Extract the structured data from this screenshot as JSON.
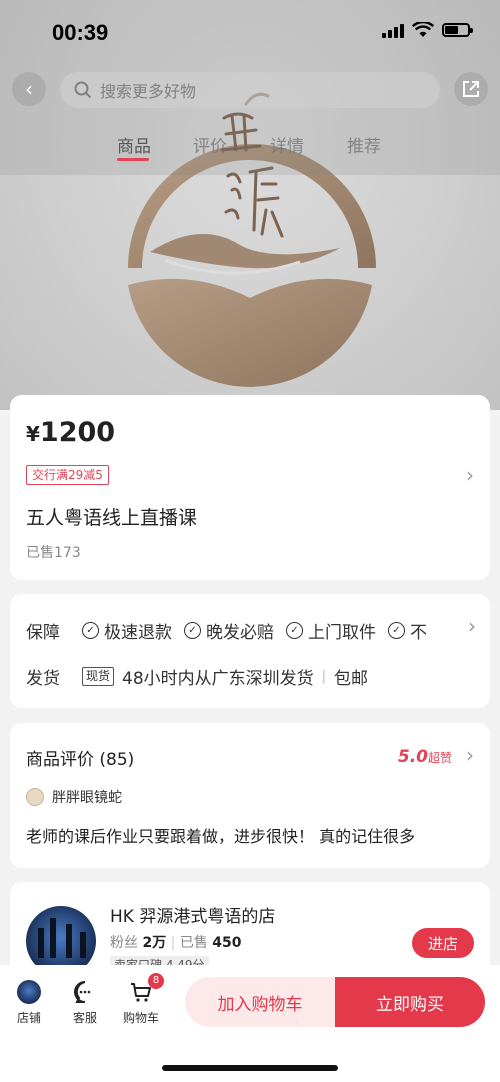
{
  "status_bar": {
    "time": "00:39"
  },
  "search": {
    "placeholder": "搜索更多好物"
  },
  "tabs": [
    {
      "label": "商品",
      "active": true
    },
    {
      "label": "评价"
    },
    {
      "label": "详情"
    },
    {
      "label": "推荐"
    }
  ],
  "hero": {
    "logo_alt": "羿源 logo"
  },
  "product": {
    "price": "1200",
    "currency": "¥",
    "promo": "交行满29减5",
    "title": "五人粤语线上直播课",
    "sold": "已售173"
  },
  "guarantee": {
    "label": "保障",
    "items": [
      "极速退款",
      "晚发必赔",
      "上门取件",
      "不"
    ]
  },
  "shipping": {
    "label": "发货",
    "stock_tag": "现货",
    "text": "48小时内从广东深圳发货",
    "divider": "|",
    "free": "包邮"
  },
  "reviews": {
    "title": "商品评价 (85)",
    "score": "5.0",
    "score_label": "超赞",
    "reviewer": "胖胖眼镜蛇",
    "text": "老师的课后作业只要跟着做，进步很快！ 真的记住很多"
  },
  "store": {
    "name": "HK 羿源港式粤语的店",
    "fans_label": "粉丝",
    "fans": "2万",
    "sold_label": "已售",
    "sold": "450",
    "rating": "卖家口碑 4.49分",
    "enter": "进店"
  },
  "bottom_bar": {
    "shop": "店铺",
    "service": "客服",
    "cart": "购物车",
    "cart_count": "8",
    "add_to_cart": "加入购物车",
    "buy_now": "立即购买"
  },
  "colors": {
    "accent": "#e3394a",
    "accent_light": "#fde8ea"
  }
}
